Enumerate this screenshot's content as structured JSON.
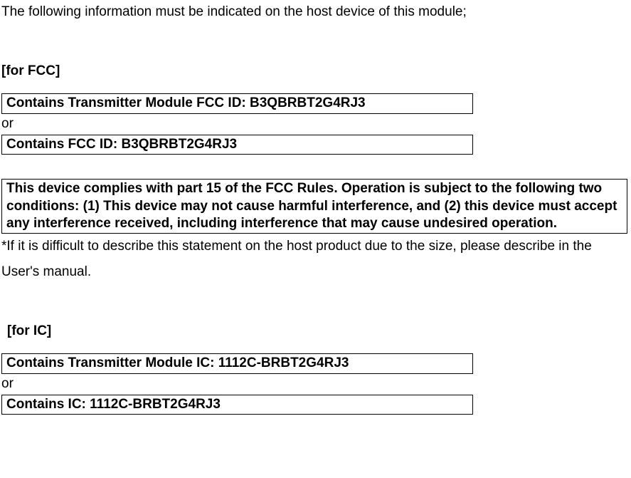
{
  "intro": "The following information must be indicated on the host device of this module;",
  "fcc": {
    "header": "[for FCC]",
    "box1": "Contains Transmitter Module FCC ID: B3QBRBT2G4RJ3",
    "or": "or",
    "box2": "Contains FCC ID: B3QBRBT2G4RJ3",
    "compliance": "This device complies with part 15 of the FCC Rules. Operation is subject to the following two conditions: (1) This device may not cause harmful interference, and (2) this device must accept any interference received, including interference that may cause undesired operation.",
    "note": "*If it is difficult to describe this statement on the host product due to the size, please describe in the User's manual."
  },
  "ic": {
    "header": "[for IC]",
    "box1": "Contains Transmitter Module IC: 1112C-BRBT2G4RJ3",
    "or": "or",
    "box2": "Contains IC: 1112C-BRBT2G4RJ3"
  }
}
